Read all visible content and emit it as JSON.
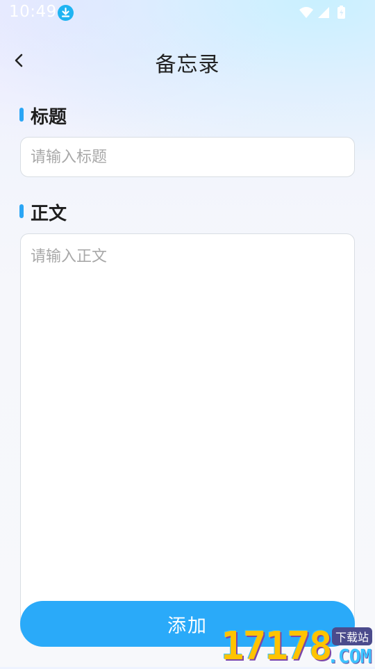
{
  "status_bar": {
    "time": "10:49"
  },
  "header": {
    "title": "备忘录"
  },
  "form": {
    "title_label": "标题",
    "title_placeholder": "请输入标题",
    "title_value": "",
    "body_label": "正文",
    "body_placeholder": "请输入正文",
    "body_value": "",
    "submit_label": "添加"
  },
  "watermark": {
    "number": "17178",
    "domain": ".COM",
    "tag": "下载站"
  },
  "colors": {
    "accent": "#2aaaf9",
    "label_bar": "#2aa6f5",
    "status_download": "#1fb4f2"
  }
}
